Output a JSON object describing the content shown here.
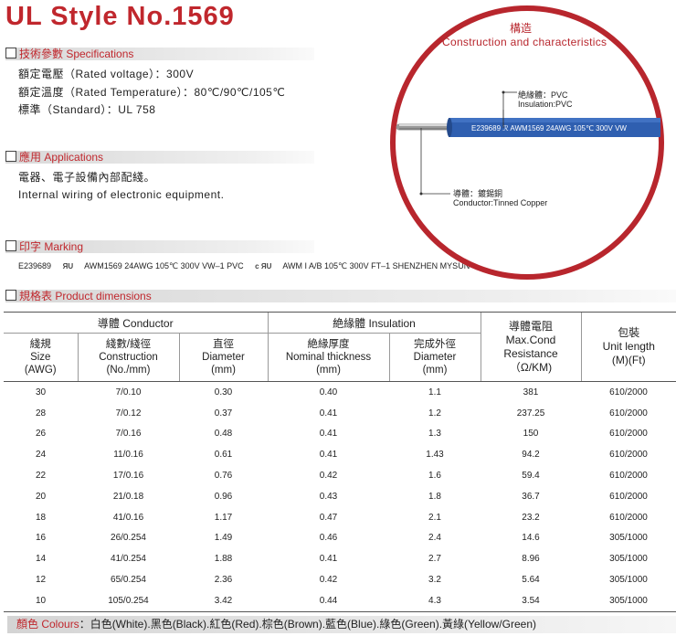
{
  "title": "UL Style No.1569",
  "sections": {
    "specifications": "技術參數 Specifications",
    "applications": "應用 Applications",
    "marking": "印字 Marking",
    "dimensions": "規格表 Product  dimensions"
  },
  "specs": {
    "voltage": "額定電壓（Rated voltage）：300V",
    "temperature": "額定溫度（Rated Temperature）：80℃/90℃/105℃",
    "standard": "標準（Standard）：UL 758"
  },
  "applications": {
    "cn": "電器、電子設備內部配綫。",
    "en": "Internal wiring of electronic equipment."
  },
  "marking": {
    "part1": "E239689",
    "logo1": "UL",
    "part2": "AWM1569 24AWG 105℃ 300V  VW–1 PVC",
    "logo2": "RU",
    "part3": "AWM I A/B 105℃ 300V  FT–1 SHENZHEN  MYSUN"
  },
  "figure": {
    "title_cn": "構造",
    "title_en": "Construction  and  characteristics",
    "insulation_cn": "絶緣體：PVC",
    "insulation_en": "Insulation:PVC",
    "conductor_cn": "導體：鍍錫銅",
    "conductor_en": "Conductor:Tinned Copper",
    "cable_print": "E239689   ℛ  AWM1569  24AWG  105℃  300V  VW"
  },
  "table": {
    "group_conductor": "導體 Conductor",
    "group_insulation": "絶緣體  Insulation",
    "resistance": [
      "導體電阻",
      "Max.Cond",
      "Resistance",
      "（Ω/KM)"
    ],
    "unit_length": [
      "包裝",
      "Unit length",
      "(M)(Ft)"
    ],
    "size": [
      "綫規",
      "Size",
      "(AWG)"
    ],
    "construction": [
      "綫數/綫徑",
      "Construction",
      "(No./mm)"
    ],
    "diameter": [
      "直徑",
      "Diameter",
      "(mm)"
    ],
    "thickness": [
      "絶緣厚度",
      "Nominal thickness",
      "(mm)"
    ],
    "outer_diameter": [
      "完成外徑",
      "Diameter",
      "(mm)"
    ],
    "rows": [
      [
        "30",
        "7/0.10",
        "0.30",
        "0.40",
        "1.1",
        "381",
        "610/2000"
      ],
      [
        "28",
        "7/0.12",
        "0.37",
        "0.41",
        "1.2",
        "237.25",
        "610/2000"
      ],
      [
        "26",
        "7/0.16",
        "0.48",
        "0.41",
        "1.3",
        "150",
        "610/2000"
      ],
      [
        "24",
        "11/0.16",
        "0.61",
        "0.41",
        "1.43",
        "94.2",
        "610/2000"
      ],
      [
        "22",
        "17/0.16",
        "0.76",
        "0.42",
        "1.6",
        "59.4",
        "610/2000"
      ],
      [
        "20",
        "21/0.18",
        "0.96",
        "0.43",
        "1.8",
        "36.7",
        "610/2000"
      ],
      [
        "18",
        "41/0.16",
        "1.17",
        "0.47",
        "2.1",
        "23.2",
        "610/2000"
      ],
      [
        "16",
        "26/0.254",
        "1.49",
        "0.46",
        "2.4",
        "14.6",
        "305/1000"
      ],
      [
        "14",
        "41/0.254",
        "1.88",
        "0.41",
        "2.7",
        "8.96",
        "305/1000"
      ],
      [
        "12",
        "65/0.254",
        "2.36",
        "0.42",
        "3.2",
        "5.64",
        "305/1000"
      ],
      [
        "10",
        "105/0.254",
        "3.42",
        "0.44",
        "4.3",
        "3.54",
        "305/1000"
      ]
    ]
  },
  "colours": {
    "label": "顏色 Colours",
    "value": "：白色(White).黑色(Black).紅色(Red).棕色(Brown).藍色(Blue).綠色(Green).黃綠(Yellow/Green)"
  },
  "colors": {
    "accent": "#c0272d",
    "cable_blue": "#2f5fb0"
  }
}
